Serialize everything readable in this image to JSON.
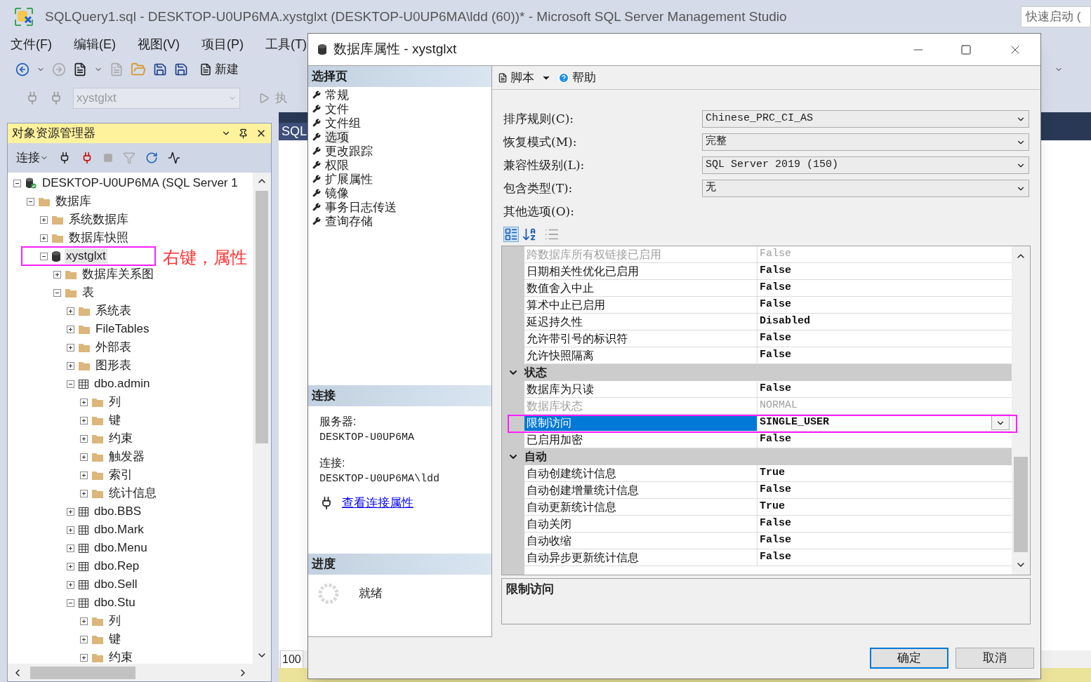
{
  "app": {
    "title": "SQLQuery1.sql - DESKTOP-U0UP6MA.xystglxt (DESKTOP-U0UP6MA\\ldd (60))* - Microsoft SQL Server Management Studio",
    "quick_launch": {
      "placeholder": "快速启动 ("
    },
    "menu": [
      "文件(F)",
      "编辑(E)",
      "视图(V)",
      "项目(P)",
      "工具(T)"
    ],
    "new_query_label": "新建",
    "db_selector": {
      "value": "xystglxt"
    },
    "execute_label": "执"
  },
  "object_explorer": {
    "title": "对象资源管理器",
    "connect_label": "连接",
    "tree": [
      {
        "label": "DESKTOP-U0UP6MA (SQL Server 1",
        "kind": "server",
        "expanded": true,
        "selected": false,
        "children": [
          {
            "label": "数据库",
            "kind": "folder",
            "expanded": true,
            "selected": false,
            "children": [
              {
                "label": "系统数据库",
                "kind": "folder",
                "expanded": false,
                "selected": false
              },
              {
                "label": "数据库快照",
                "kind": "folder",
                "expanded": false,
                "selected": false
              },
              {
                "label": "xystglxt",
                "kind": "database",
                "expanded": true,
                "selected": true,
                "children": [
                  {
                    "label": "数据库关系图",
                    "kind": "folder",
                    "expanded": false,
                    "selected": false
                  },
                  {
                    "label": "表",
                    "kind": "folder",
                    "expanded": true,
                    "selected": false,
                    "children": [
                      {
                        "label": "系统表",
                        "kind": "folder",
                        "expanded": false,
                        "selected": false
                      },
                      {
                        "label": "FileTables",
                        "kind": "folder",
                        "expanded": false,
                        "selected": false
                      },
                      {
                        "label": "外部表",
                        "kind": "folder",
                        "expanded": false,
                        "selected": false
                      },
                      {
                        "label": "图形表",
                        "kind": "folder",
                        "expanded": false,
                        "selected": false
                      },
                      {
                        "label": "dbo.admin",
                        "kind": "table",
                        "expanded": true,
                        "selected": false,
                        "children": [
                          {
                            "label": "列",
                            "kind": "folder",
                            "expanded": false,
                            "selected": false
                          },
                          {
                            "label": "键",
                            "kind": "folder",
                            "expanded": false,
                            "selected": false
                          },
                          {
                            "label": "约束",
                            "kind": "folder",
                            "expanded": false,
                            "selected": false
                          },
                          {
                            "label": "触发器",
                            "kind": "folder",
                            "expanded": false,
                            "selected": false
                          },
                          {
                            "label": "索引",
                            "kind": "folder",
                            "expanded": false,
                            "selected": false
                          },
                          {
                            "label": "统计信息",
                            "kind": "folder",
                            "expanded": false,
                            "selected": false
                          }
                        ]
                      },
                      {
                        "label": "dbo.BBS",
                        "kind": "table",
                        "expanded": false,
                        "selected": false
                      },
                      {
                        "label": "dbo.Mark",
                        "kind": "table",
                        "expanded": false,
                        "selected": false
                      },
                      {
                        "label": "dbo.Menu",
                        "kind": "table",
                        "expanded": false,
                        "selected": false
                      },
                      {
                        "label": "dbo.Rep",
                        "kind": "table",
                        "expanded": false,
                        "selected": false
                      },
                      {
                        "label": "dbo.Sell",
                        "kind": "table",
                        "expanded": false,
                        "selected": false
                      },
                      {
                        "label": "dbo.Stu",
                        "kind": "table",
                        "expanded": true,
                        "selected": false,
                        "children": [
                          {
                            "label": "列",
                            "kind": "folder",
                            "expanded": false,
                            "selected": false
                          },
                          {
                            "label": "键",
                            "kind": "folder",
                            "expanded": false,
                            "selected": false
                          },
                          {
                            "label": "约束",
                            "kind": "folder",
                            "expanded": false,
                            "selected": false
                          }
                        ]
                      }
                    ]
                  }
                ]
              }
            ]
          }
        ]
      }
    ]
  },
  "annotation": {
    "text": "右键，属性"
  },
  "editor": {
    "tab": "SQL",
    "zoom": "100"
  },
  "dialog": {
    "title": "数据库属性 - xystglxt",
    "pages_header": "选择页",
    "pages": [
      {
        "label": "常规",
        "selected": false
      },
      {
        "label": "文件",
        "selected": false
      },
      {
        "label": "文件组",
        "selected": false
      },
      {
        "label": "选项",
        "selected": true
      },
      {
        "label": "更改跟踪",
        "selected": false
      },
      {
        "label": "权限",
        "selected": false
      },
      {
        "label": "扩展属性",
        "selected": false
      },
      {
        "label": "镜像",
        "selected": false
      },
      {
        "label": "事务日志传送",
        "selected": false
      },
      {
        "label": "查询存储",
        "selected": false
      }
    ],
    "connection_header": "连接",
    "server_label": "服务器:",
    "server": "DESKTOP-U0UP6MA",
    "connection_label": "连接:",
    "connection": "DESKTOP-U0UP6MA\\ldd",
    "connection_link": "查看连接属性",
    "progress_header": "进度",
    "progress_status": "就绪",
    "toolbar": [
      {
        "label": "脚本",
        "kind": "script"
      },
      {
        "label": "帮助",
        "kind": "help"
      }
    ],
    "fields": [
      {
        "label": "排序规则(C):",
        "value": "Chinese_PRC_CI_AS"
      },
      {
        "label": "恢复模式(M):",
        "value": "完整"
      },
      {
        "label": "兼容性级别(L):",
        "value": "SQL Server 2019 (150)"
      },
      {
        "label": "包含类型(T):",
        "value": "无"
      }
    ],
    "other_options_label": "其他选项(O):",
    "grid": [
      {
        "kind": "property",
        "name": "跨数据库所有权链接已启用",
        "value": "False",
        "disabled": true,
        "selected": false
      },
      {
        "kind": "property",
        "name": "日期相关性优化已启用",
        "value": "False",
        "disabled": false,
        "selected": false
      },
      {
        "kind": "property",
        "name": "数值舍入中止",
        "value": "False",
        "disabled": false,
        "selected": false
      },
      {
        "kind": "property",
        "name": "算术中止已启用",
        "value": "False",
        "disabled": false,
        "selected": false
      },
      {
        "kind": "property",
        "name": "延迟持久性",
        "value": "Disabled",
        "disabled": false,
        "selected": false
      },
      {
        "kind": "property",
        "name": "允许带引号的标识符",
        "value": "False",
        "disabled": false,
        "selected": false
      },
      {
        "kind": "property",
        "name": "允许快照隔离",
        "value": "False",
        "disabled": false,
        "selected": false
      },
      {
        "kind": "category",
        "name": "状态",
        "expanded": true
      },
      {
        "kind": "property",
        "name": "数据库为只读",
        "value": "False",
        "disabled": false,
        "selected": false
      },
      {
        "kind": "property",
        "name": "数据库状态",
        "value": "NORMAL",
        "disabled": true,
        "selected": false
      },
      {
        "kind": "property",
        "name": "限制访问",
        "value": "SINGLE_USER",
        "disabled": false,
        "selected": true
      },
      {
        "kind": "property",
        "name": "已启用加密",
        "value": "False",
        "disabled": false,
        "selected": false
      },
      {
        "kind": "category",
        "name": "自动",
        "expanded": true
      },
      {
        "kind": "property",
        "name": "自动创建统计信息",
        "value": "True",
        "disabled": false,
        "selected": false
      },
      {
        "kind": "property",
        "name": "自动创建增量统计信息",
        "value": "False",
        "disabled": false,
        "selected": false
      },
      {
        "kind": "property",
        "name": "自动更新统计信息",
        "value": "True",
        "disabled": false,
        "selected": false
      },
      {
        "kind": "property",
        "name": "自动关闭",
        "value": "False",
        "disabled": false,
        "selected": false
      },
      {
        "kind": "property",
        "name": "自动收缩",
        "value": "False",
        "disabled": false,
        "selected": false
      },
      {
        "kind": "property",
        "name": "自动异步更新统计信息",
        "value": "False",
        "disabled": false,
        "selected": false
      }
    ],
    "description": "限制访问",
    "buttons": [
      {
        "label": "确定",
        "default": true
      },
      {
        "label": "取消",
        "default": false
      }
    ]
  }
}
